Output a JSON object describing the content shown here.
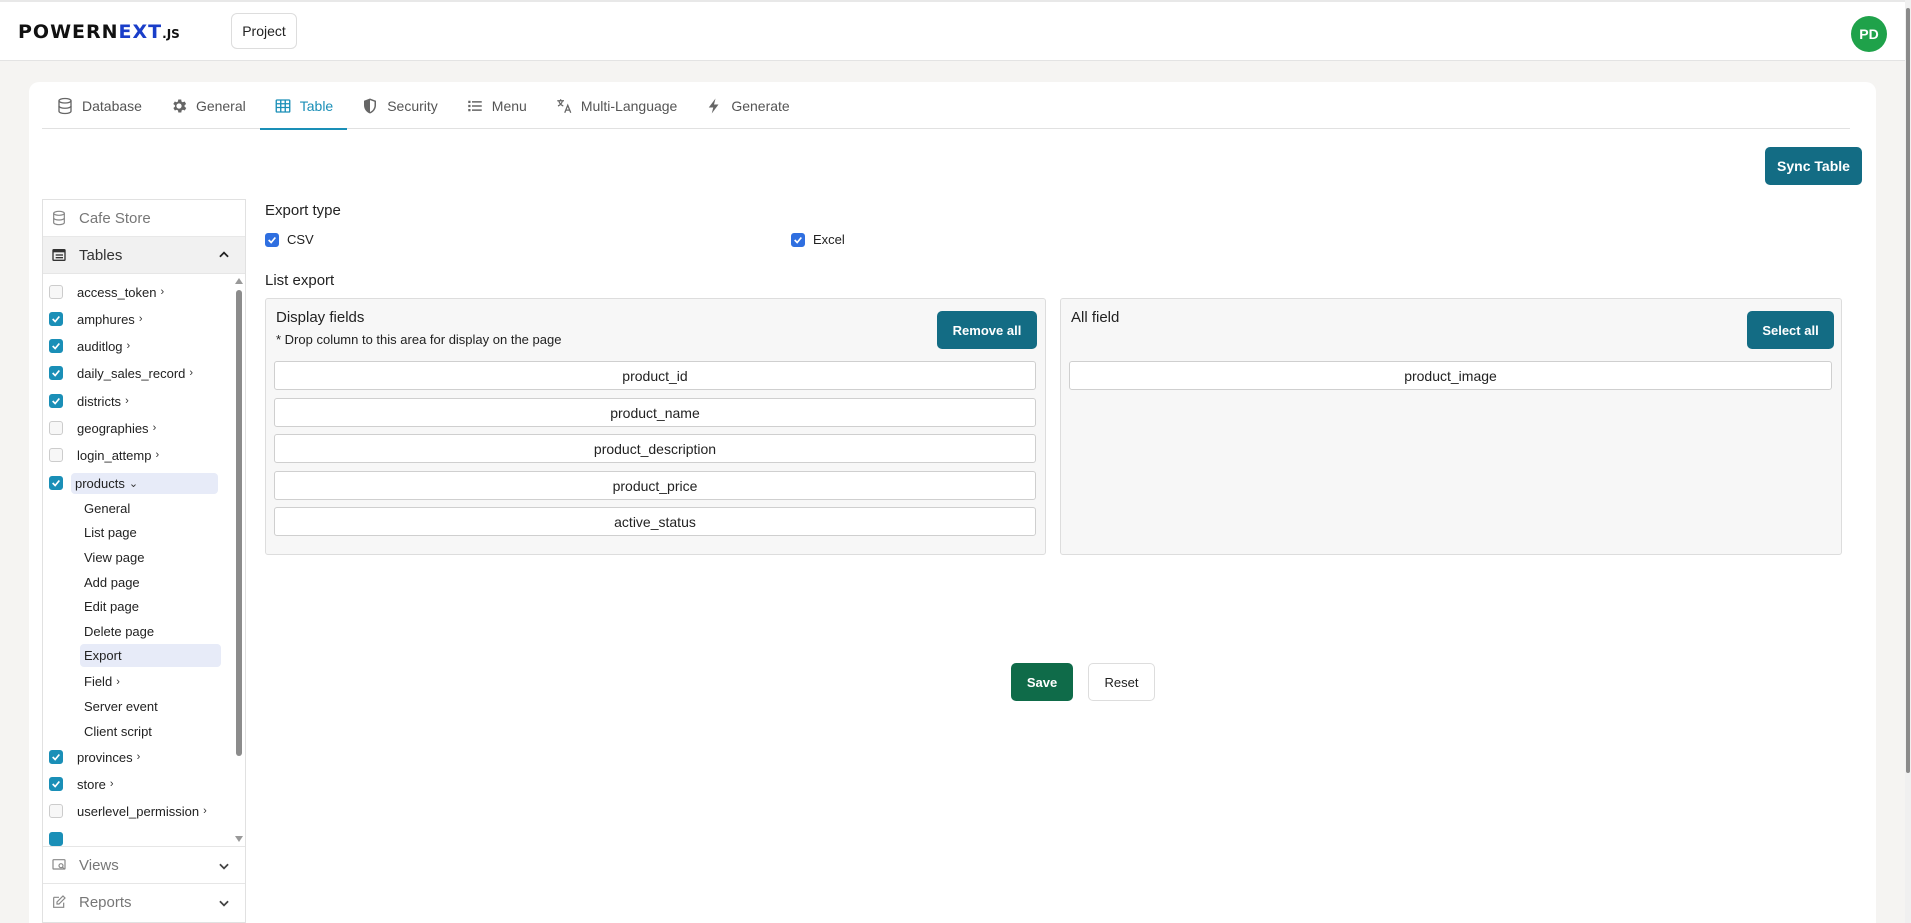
{
  "header": {
    "logo_main": "POWERN",
    "logo_accent": "EXT",
    "logo_suffix": ".JS",
    "project_label": "Project",
    "avatar_initials": "PD",
    "avatar_color": "#1fa24a"
  },
  "tabs": [
    {
      "label": "Database",
      "icon": "database-icon",
      "active": false
    },
    {
      "label": "General",
      "icon": "gear-icon",
      "active": false
    },
    {
      "label": "Table",
      "icon": "table-icon",
      "active": true
    },
    {
      "label": "Security",
      "icon": "shield-icon",
      "active": false
    },
    {
      "label": "Menu",
      "icon": "list-icon",
      "active": false
    },
    {
      "label": "Multi-Language",
      "icon": "translate-icon",
      "active": false
    },
    {
      "label": "Generate",
      "icon": "bolt-icon",
      "active": false
    }
  ],
  "sync_label": "Sync Table",
  "sidebar": {
    "db_name": "Cafe Store",
    "tables_label": "Tables",
    "tables": [
      {
        "name": "access_token",
        "checked": false
      },
      {
        "name": "amphures",
        "checked": true
      },
      {
        "name": "auditlog",
        "checked": true
      },
      {
        "name": "daily_sales_record",
        "checked": true
      },
      {
        "name": "districts",
        "checked": true
      },
      {
        "name": "geographies",
        "checked": false
      },
      {
        "name": "login_attemp",
        "checked": false
      },
      {
        "name": "products",
        "checked": true,
        "expanded": true
      },
      {
        "name": "provinces",
        "checked": true
      },
      {
        "name": "store",
        "checked": true
      },
      {
        "name": "userlevel_permission",
        "checked": false
      }
    ],
    "product_subitems": [
      "General",
      "List page",
      "View page",
      "Add page",
      "Edit page",
      "Delete page",
      "Export",
      "Field",
      "Server event",
      "Client script"
    ],
    "selected_subitem": "Export",
    "views_label": "Views",
    "reports_label": "Reports"
  },
  "content": {
    "export_type_label": "Export type",
    "csv_label": "CSV",
    "excel_label": "Excel",
    "csv_checked": true,
    "excel_checked": true,
    "list_export_label": "List export",
    "display_panel": {
      "title": "Display fields",
      "hint": "* Drop column to this area for display on the page",
      "button": "Remove all",
      "fields": [
        "product_id",
        "product_name",
        "product_description",
        "product_price",
        "active_status"
      ]
    },
    "all_panel": {
      "title": "All field",
      "button": "Select all",
      "fields": [
        "product_image"
      ]
    },
    "save_label": "Save",
    "reset_label": "Reset"
  },
  "colors": {
    "accent": "#1a8fb7",
    "primary_button": "#136c84",
    "save_button": "#0f6b49"
  }
}
